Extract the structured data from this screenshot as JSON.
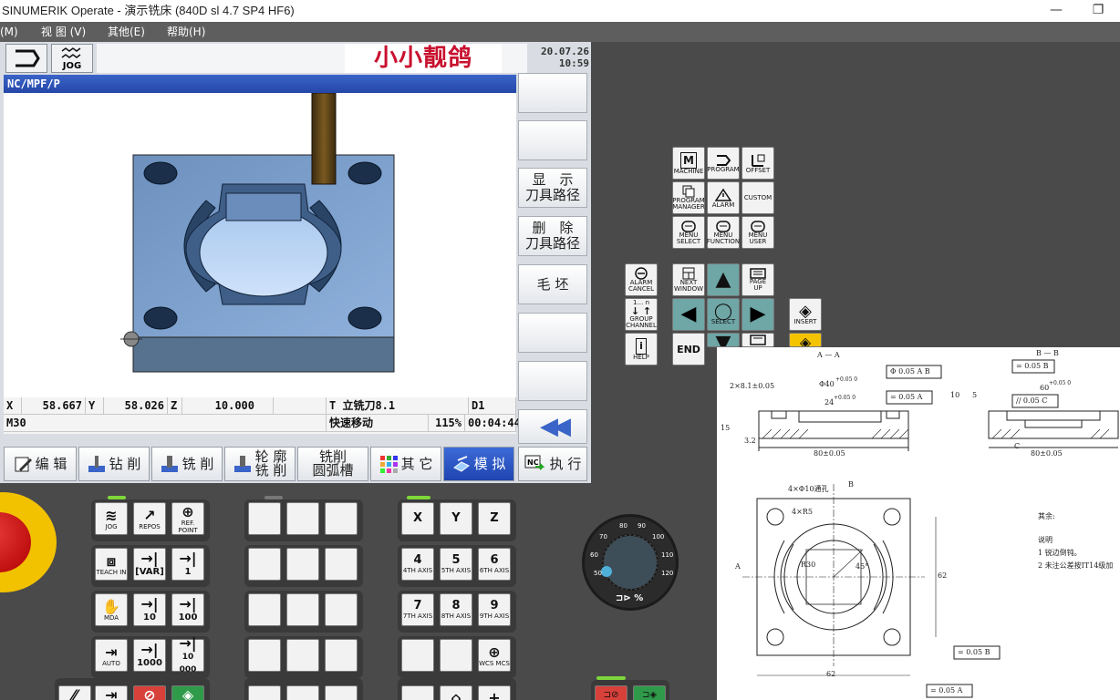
{
  "window": {
    "title": "SINUMERIK Operate - 演示铣床 (840D sl 4.7 SP4 HF6)"
  },
  "menu": {
    "items": [
      "(M)",
      "视 图 (V)",
      "其他(E)",
      "帮助(H)"
    ]
  },
  "hmi_header": {
    "mode_label": "JOG",
    "logo_text": "小小靓鸽",
    "date": "20.07.26",
    "time": "10:59"
  },
  "path": "NC/MPF/P",
  "status": {
    "x_label": "X",
    "x_value": "58.667",
    "y_label": "Y",
    "y_value": "58.026",
    "z_label": "Z",
    "z_value": "10.000",
    "tool": "T 立铣刀8.1",
    "d": "D1",
    "mcode": "M30",
    "motion": "快速移动",
    "feed_override": "115%",
    "time": "00:04:44"
  },
  "vertical_softkeys": [
    {
      "lines": [
        "",
        ""
      ]
    },
    {
      "lines": [
        "",
        ""
      ]
    },
    {
      "lines": [
        "显　示",
        "刀具路径"
      ]
    },
    {
      "lines": [
        "删　除",
        "刀具路径"
      ]
    },
    {
      "lines": [
        "毛 坯",
        ""
      ]
    },
    {
      "lines": [
        "",
        ""
      ]
    },
    {
      "lines": [
        "",
        ""
      ]
    }
  ],
  "horizontal_softkeys": [
    {
      "line1": "编 辑",
      "line2": ""
    },
    {
      "line1": "钻 削",
      "line2": ""
    },
    {
      "line1": "铣 削",
      "line2": ""
    },
    {
      "line1": "轮 廓",
      "line2": "铣 削"
    },
    {
      "line1": "铣削",
      "line2": "圆弧槽"
    },
    {
      "line1": "其 它",
      "line2": ""
    },
    {
      "line1": "模 拟",
      "line2": ""
    },
    {
      "line1": "执 行",
      "line2": ""
    }
  ],
  "keypad": {
    "machine": "MACHINE",
    "program": "PROGRAM",
    "offset": "OFFSET",
    "program_manager_1": "PROGRAM",
    "program_manager_2": "MANAGER",
    "alarm": "ALARM",
    "custom": "CUSTOM",
    "menu_select_1": "MENU",
    "menu_select_2": "SELECT",
    "menu_function_1": "MENU",
    "menu_function_2": "FUNCTION",
    "menu_user_1": "MENU",
    "menu_user_2": "USER",
    "alarm_cancel_1": "ALARM",
    "alarm_cancel_2": "CANCEL",
    "next_window_1": "NEXT",
    "next_window_2": "WINDOW",
    "page_up_1": "PAGE",
    "page_up_2": "UP",
    "group_channel_1": "GROUP",
    "group_channel_2": "CHANNEL",
    "group_channel_top": "1… n",
    "select": "SELECT",
    "insert": "INSERT",
    "help": "HELP",
    "end": "END"
  },
  "mcp": {
    "jog": "JOG",
    "repos": "REPOS",
    "ref_point": "REF. POINT",
    "teach_in": "TEACH IN",
    "var": "[VAR]",
    "inc1": "1",
    "mda": "MDA",
    "inc10": "10",
    "inc100": "100",
    "auto": "AUTO",
    "inc1000": "1000",
    "inc10000": "10 000",
    "x": "X",
    "y": "Y",
    "z": "Z",
    "a4": "4",
    "a4s": "4TH AXIS",
    "a5": "5",
    "a5s": "5TH AXIS",
    "a6": "6",
    "a6s": "6TH AXIS",
    "a7": "7",
    "a7s": "7TH AXIS",
    "a8": "8",
    "a8s": "8TH AXIS",
    "a9": "9",
    "a9s": "9TH AXIS",
    "wcs_mcs": "WCS MCS",
    "dial_ticks": [
      "50",
      "60",
      "70",
      "80",
      "90",
      "100",
      "110",
      "120"
    ],
    "dial_unit": "%"
  },
  "drawing": {
    "section_aa": "A — A",
    "section_bb": "B — B",
    "dim_28": "2×8.1±0.05",
    "dim_phi40": "Φ40",
    "dim_phi40_tol": "+0.05 0",
    "dim_24": "24",
    "dim_24_tol": "+0.05 0",
    "dim_80a": "80±0.05",
    "dim_80b": "80±0.05",
    "dim_60": "60",
    "dim_60_tol": "+0.05 0",
    "dim_10": "10",
    "dim_5": "5",
    "dim_15": "15",
    "gdt_pos": "Φ 0.05 A B",
    "gdt_flat1": "= 0.05 A",
    "gdt_flat2": "= 0.05 B",
    "gdt_par": "// 0.05 C",
    "gdt_flat3": "= 0.05 B",
    "gdt_flat4": "= 0.05 A",
    "holes": "4×Φ10通孔",
    "r5": "4×R5",
    "r30": "R30",
    "ang45": "45°",
    "dim_62a": "62",
    "dim_62b": "62",
    "datum_a": "A",
    "datum_b": "B",
    "datum_c": "C",
    "roughness": "3.2",
    "rest_label": "其余:",
    "notes_title": "说明",
    "note1": "1 锐边倒钝。",
    "note2": "2 未注公差按IT14级加"
  }
}
